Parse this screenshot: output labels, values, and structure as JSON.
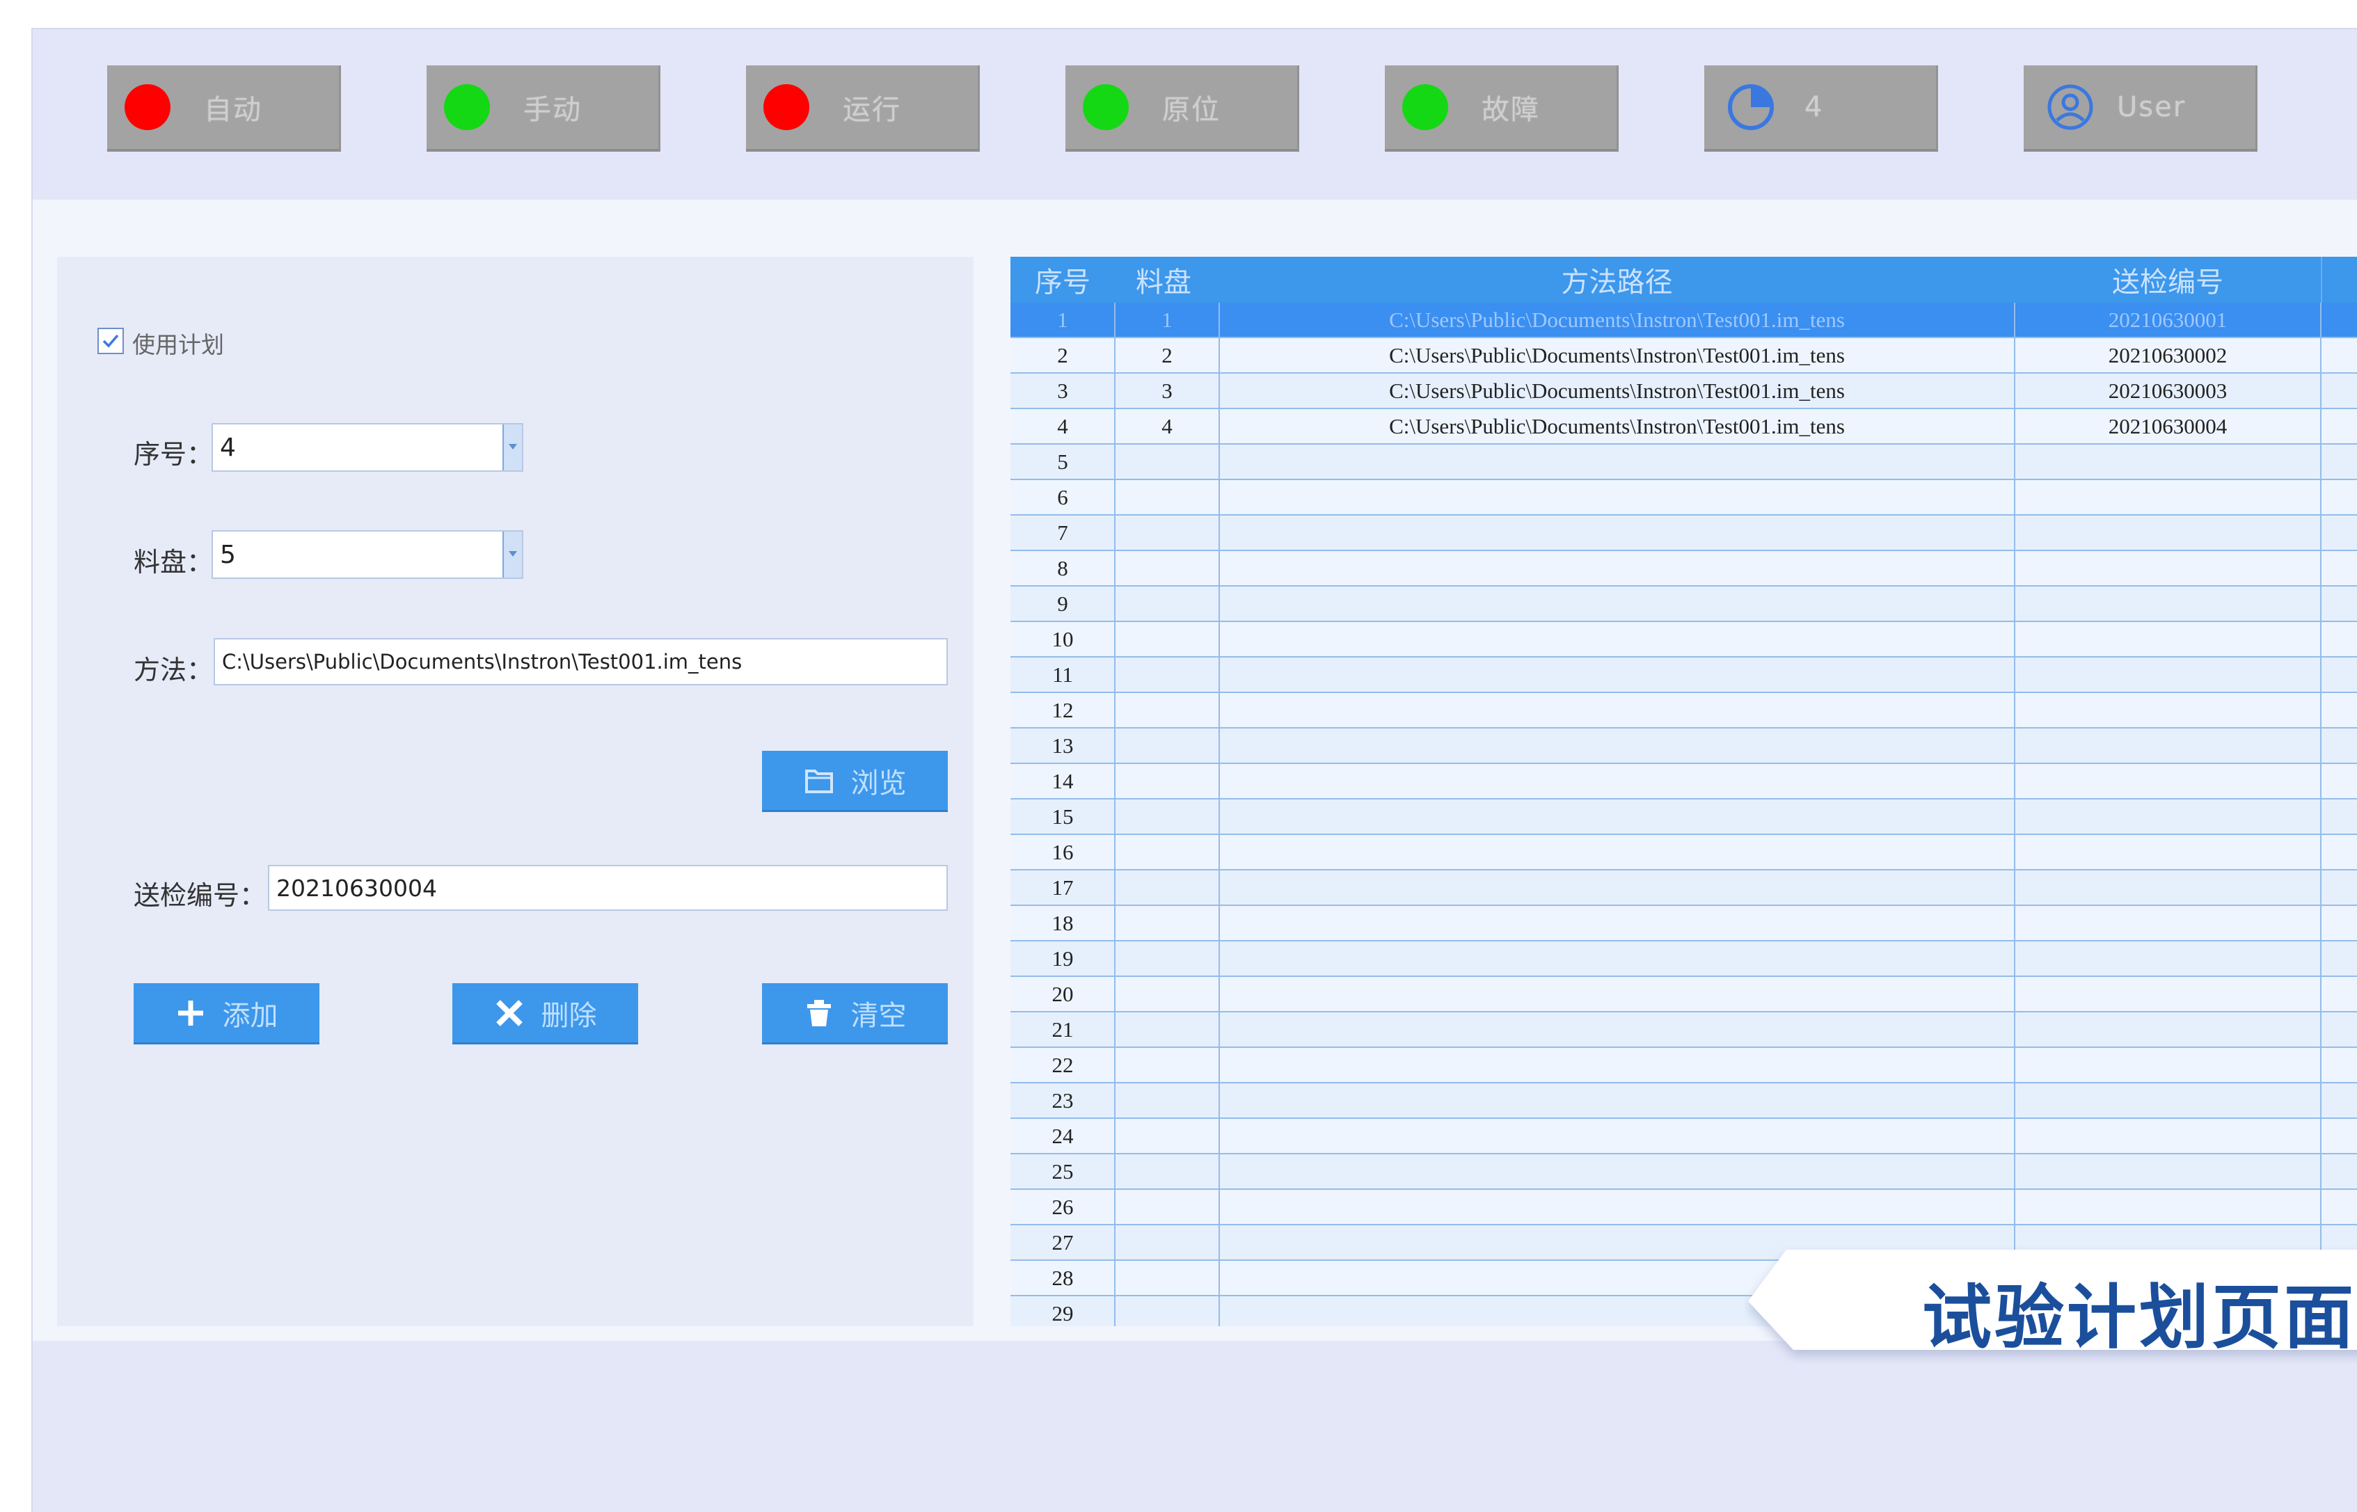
{
  "status_bar": {
    "buttons": [
      {
        "label": "自动",
        "indicator_color": "#ff0000"
      },
      {
        "label": "手动",
        "indicator_color": "#14d814"
      },
      {
        "label": "运行",
        "indicator_color": "#ff0000"
      },
      {
        "label": "原位",
        "indicator_color": "#14d814"
      },
      {
        "label": "故障",
        "indicator_color": "#14d814"
      },
      {
        "label": "4",
        "icon": "clock-pie-icon"
      },
      {
        "label": "User",
        "icon": "user-circle-icon"
      }
    ]
  },
  "form": {
    "use_plan_label": "使用计划",
    "use_plan_checked": true,
    "seq_label": "序号：",
    "seq_value": "4",
    "tray_label": "料盘：",
    "tray_value": "5",
    "method_label": "方法：",
    "method_value": "C:\\Users\\Public\\Documents\\Instron\\Test001.im_tens",
    "browse_label": "浏览",
    "sample_no_label": "送检编号：",
    "sample_no_value": "20210630004",
    "add_label": "添加",
    "delete_label": "删除",
    "clear_label": "清空"
  },
  "table": {
    "columns": [
      "序号",
      "料盘",
      "方法路径",
      "送检编号"
    ],
    "rows": [
      {
        "seq": "1",
        "tray": "1",
        "path": "C:\\Users\\Public\\Documents\\Instron\\Test001.im_tens",
        "sample": "20210630001",
        "selected": true
      },
      {
        "seq": "2",
        "tray": "2",
        "path": "C:\\Users\\Public\\Documents\\Instron\\Test001.im_tens",
        "sample": "20210630002"
      },
      {
        "seq": "3",
        "tray": "3",
        "path": "C:\\Users\\Public\\Documents\\Instron\\Test001.im_tens",
        "sample": "20210630003"
      },
      {
        "seq": "4",
        "tray": "4",
        "path": "C:\\Users\\Public\\Documents\\Instron\\Test001.im_tens",
        "sample": "20210630004"
      },
      {
        "seq": "5"
      },
      {
        "seq": "6"
      },
      {
        "seq": "7"
      },
      {
        "seq": "8"
      },
      {
        "seq": "9"
      },
      {
        "seq": "10"
      },
      {
        "seq": "11"
      },
      {
        "seq": "12"
      },
      {
        "seq": "13"
      },
      {
        "seq": "14"
      },
      {
        "seq": "15"
      },
      {
        "seq": "16"
      },
      {
        "seq": "17"
      },
      {
        "seq": "18"
      },
      {
        "seq": "19"
      },
      {
        "seq": "20"
      },
      {
        "seq": "21"
      },
      {
        "seq": "22"
      },
      {
        "seq": "23"
      },
      {
        "seq": "24"
      },
      {
        "seq": "25"
      },
      {
        "seq": "26"
      },
      {
        "seq": "27"
      },
      {
        "seq": "28"
      },
      {
        "seq": "29"
      }
    ]
  },
  "callout": {
    "text": "试验计划页面"
  }
}
